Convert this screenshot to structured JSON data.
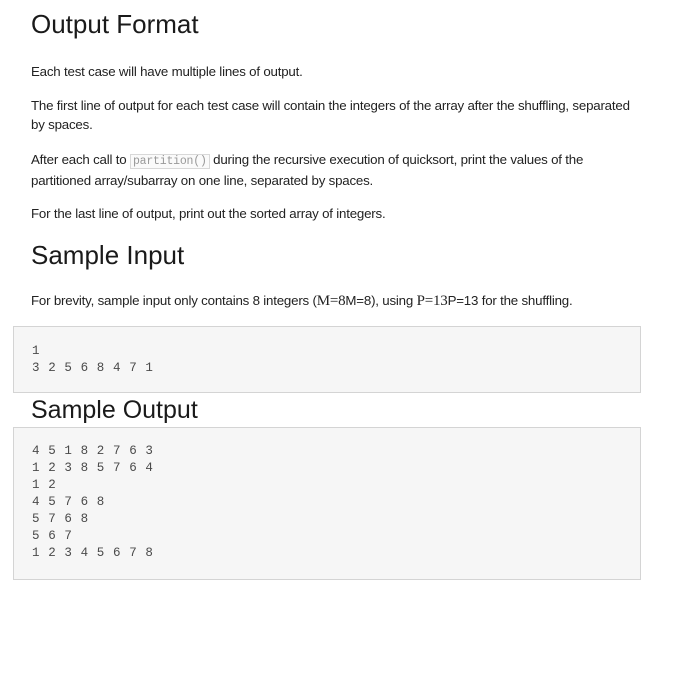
{
  "output_format": {
    "heading": "Output Format",
    "para1": "Each test case will have multiple lines of output.",
    "para2": "The first line of output for each test case will contain the integers of the array after the shuffling, separated by spaces.",
    "para3_before": "After each call to ",
    "para3_code": "partition()",
    "para3_after": " during the recursive execution of quicksort, print the values of the partitioned array/subarray on one line, separated by spaces.",
    "para4": "For the last line of output, print out the sorted array of integers."
  },
  "sample_input": {
    "heading": "Sample Input",
    "desc_before": "For brevity, sample input only contains 8 integers (",
    "desc_math1": "M=8",
    "desc_plain1": "M=8",
    "desc_mid": "), using ",
    "desc_math2": "P=13",
    "desc_plain2": "P=13",
    "desc_after": " for the shuffling.",
    "lines": [
      "1",
      "3 2 5 6 8 4 7 1"
    ]
  },
  "sample_output": {
    "heading": "Sample Output",
    "lines": [
      "4 5 1 8 2 7 6 3",
      "1 2 3 8 5 7 6 4",
      "1 2",
      "4 5 7 6 8",
      "5 7 6 8",
      "5 6 7",
      "1 2 3 4 5 6 7 8"
    ]
  }
}
